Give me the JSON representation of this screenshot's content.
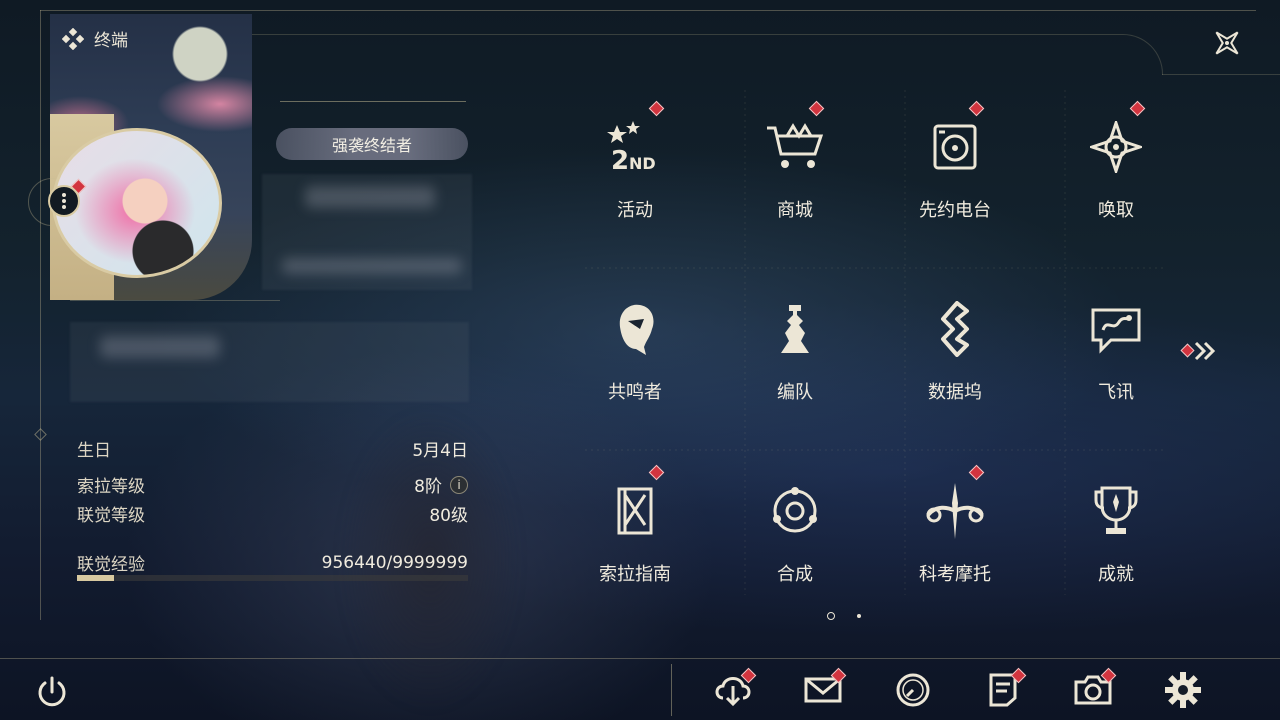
{
  "header": {
    "title": "终端"
  },
  "profile": {
    "title_badge": "强袭终结者",
    "stats": [
      {
        "key": "生日",
        "value": "5月4日"
      },
      {
        "key": "索拉等级",
        "value": "8阶"
      },
      {
        "key": "联觉等级",
        "value": "80级"
      },
      {
        "key": "联觉经验",
        "value": "956440/9999999"
      }
    ],
    "exp_progress": 0.0956
  },
  "menu": {
    "items": [
      {
        "label": "活动",
        "icon": "event-2nd-anniversary-icon",
        "badge": true
      },
      {
        "label": "商城",
        "icon": "shop-crown-cart-icon",
        "badge": true
      },
      {
        "label": "先约电台",
        "icon": "radio-icon",
        "badge": true
      },
      {
        "label": "唤取",
        "icon": "convene-compass-icon",
        "badge": true
      },
      {
        "label": "共鸣者",
        "icon": "resonator-head-icon",
        "badge": false
      },
      {
        "label": "编队",
        "icon": "team-chess-icon",
        "badge": false
      },
      {
        "label": "数据坞",
        "icon": "data-bank-icon",
        "badge": false
      },
      {
        "label": "飞讯",
        "icon": "message-chat-icon",
        "badge": false
      },
      {
        "label": "索拉指南",
        "icon": "guidebook-icon",
        "badge": true
      },
      {
        "label": "合成",
        "icon": "synthesis-orbit-icon",
        "badge": false
      },
      {
        "label": "科考摩托",
        "icon": "motorbike-icon",
        "badge": true
      },
      {
        "label": "成就",
        "icon": "achievement-trophy-icon",
        "badge": false
      }
    ],
    "page": 1,
    "page_count": 2
  },
  "bottom_bar": {
    "buttons": [
      {
        "icon": "download-cloud-icon",
        "badge": true
      },
      {
        "icon": "mail-icon",
        "badge": true
      },
      {
        "icon": "clock-icon",
        "badge": false
      },
      {
        "icon": "notice-doc-icon",
        "badge": true
      },
      {
        "icon": "camera-icon",
        "badge": true
      },
      {
        "icon": "settings-gear-icon",
        "badge": false
      }
    ]
  },
  "colors": {
    "accent_gold": "#d8c9a0",
    "badge_red": "#d2343f",
    "text": "#ece6d6"
  }
}
